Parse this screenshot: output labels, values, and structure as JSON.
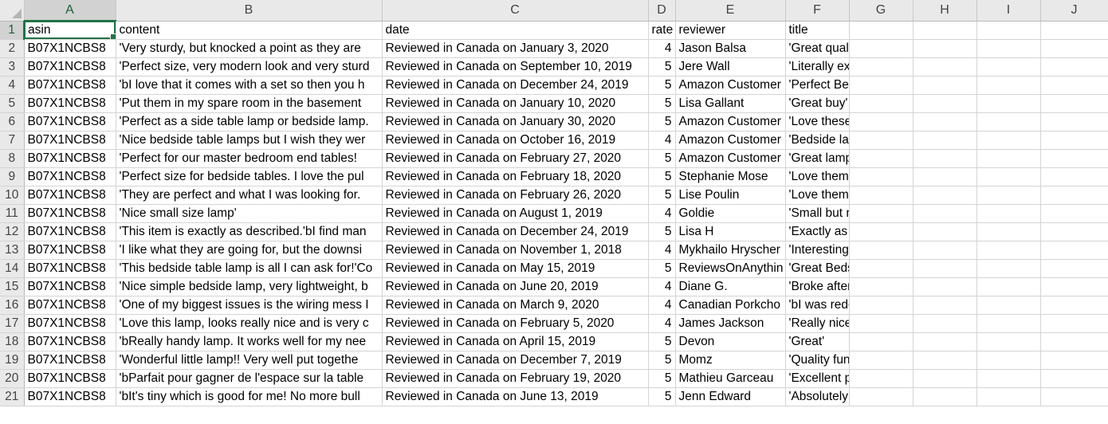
{
  "columns": [
    "A",
    "B",
    "C",
    "D",
    "E",
    "F",
    "G",
    "H",
    "I",
    "J"
  ],
  "header_row": {
    "row_number": "1",
    "cells": [
      "asin",
      "content",
      "date",
      "rate",
      "reviewer",
      "title",
      "",
      "",
      "",
      ""
    ]
  },
  "rows": [
    {
      "n": "2",
      "asin": "B07X1NCBS8",
      "content": "'Very sturdy, but knocked a point as they are",
      "date": "Reviewed in Canada on January 3, 2020",
      "rate": "4",
      "reviewer": "Jason Balsa",
      "title": "'Great quality for the money, but also quite large.'"
    },
    {
      "n": "3",
      "asin": "B07X1NCBS8",
      "content": "'Perfect size, very modern look and very sturd",
      "date": "Reviewed in Canada on September 10, 2019",
      "rate": "5",
      "reviewer": "Jere Wall",
      "title": "'Literally exactly what I was looking for!'"
    },
    {
      "n": "4",
      "asin": "B07X1NCBS8",
      "content": "'bI love that it comes with a set so then you h",
      "date": "Reviewed in Canada on December 24, 2019",
      "rate": "5",
      "reviewer": "Amazon Customer",
      "title": "'Perfect Bedroom Lamps!'"
    },
    {
      "n": "5",
      "asin": "B07X1NCBS8",
      "content": "'Put them in my spare room in the basement",
      "date": "Reviewed in Canada on January 10, 2020",
      "rate": "5",
      "reviewer": "Lisa Gallant",
      "title": "'Great buy'"
    },
    {
      "n": "6",
      "asin": "B07X1NCBS8",
      "content": "'Perfect as a side table lamp or bedside lamp.",
      "date": "Reviewed in Canada on January 30, 2020",
      "rate": "5",
      "reviewer": "Amazon Customer",
      "title": "'Love these lamps'"
    },
    {
      "n": "7",
      "asin": "B07X1NCBS8",
      "content": "'Nice bedside table lamps but I wish they wer",
      "date": "Reviewed in Canada on October 16, 2019",
      "rate": "4",
      "reviewer": "Amazon Customer",
      "title": "'Bedside lamps'"
    },
    {
      "n": "8",
      "asin": "B07X1NCBS8",
      "content": "'Perfect for our master bedroom end tables!",
      "date": "Reviewed in Canada on February 27, 2020",
      "rate": "5",
      "reviewer": "Amazon Customer",
      "title": "'Great lamps, perfect for bedroom'"
    },
    {
      "n": "9",
      "asin": "B07X1NCBS8",
      "content": "'Perfect size for bedside tables. I love the pul",
      "date": "Reviewed in Canada on February 18, 2020",
      "rate": "5",
      "reviewer": "Stephanie Mose",
      "title": "'Love them'"
    },
    {
      "n": "10",
      "asin": "B07X1NCBS8",
      "content": "'They are perfect and what I was looking for.",
      "date": "Reviewed in Canada on February 26, 2020",
      "rate": "5",
      "reviewer": "Lise Poulin",
      "title": "'Love them'"
    },
    {
      "n": "11",
      "asin": "B07X1NCBS8",
      "content": "'Nice small size lamp'",
      "date": "Reviewed in Canada on August 1, 2019",
      "rate": "4",
      "reviewer": "Goldie",
      "title": "'Small but nice'"
    },
    {
      "n": "12",
      "asin": "B07X1NCBS8",
      "content": "'This item is exactly as described.'bI find man",
      "date": "Reviewed in Canada on December 24, 2019",
      "rate": "5",
      "reviewer": "Lisa H",
      "title": "'Exactly as described, and perfect for my needs'"
    },
    {
      "n": "13",
      "asin": "B07X1NCBS8",
      "content": "'I like what they are going for, but the downsi",
      "date": "Reviewed in Canada on November 1, 2018",
      "rate": "4",
      "reviewer": "Mykhailo Hryscher",
      "title": "'Interesting, but could have bought something better.'"
    },
    {
      "n": "14",
      "asin": "B07X1NCBS8",
      "content": "'This bedside table lamp is all I can ask for!'Co",
      "date": "Reviewed in Canada on May 15, 2019",
      "rate": "5",
      "reviewer": "ReviewsOnAnythin",
      "title": "'Great Bedside Table Lamp!'"
    },
    {
      "n": "15",
      "asin": "B07X1NCBS8",
      "content": "'Nice simple bedside lamp, very lightweight, b",
      "date": "Reviewed in Canada on June 20, 2019",
      "rate": "4",
      "reviewer": "Diane G.",
      "title": "'Broke after one tip over'"
    },
    {
      "n": "16",
      "asin": "B07X1NCBS8",
      "content": "'One of my biggest issues is the wiring mess I",
      "date": "Reviewed in Canada on March 9, 2020",
      "rate": "4",
      "reviewer": "Canadian Porkcho",
      "title": "'bI was redoing everything in my bedroom, I've been loo"
    },
    {
      "n": "17",
      "asin": "B07X1NCBS8",
      "content": "'Love this lamp, looks really nice and is very c",
      "date": "Reviewed in Canada on February 5, 2020",
      "rate": "4",
      "reviewer": "James Jackson",
      "title": "'Really nice lamp'"
    },
    {
      "n": "18",
      "asin": "B07X1NCBS8",
      "content": "'bReally handy lamp. It works well for my nee",
      "date": "Reviewed in Canada on April 15, 2019",
      "rate": "5",
      "reviewer": "Devon",
      "title": "'Great'"
    },
    {
      "n": "19",
      "asin": "B07X1NCBS8",
      "content": "'Wonderful little lamp!! Very well put togethe",
      "date": "Reviewed in Canada on December 7, 2019",
      "rate": "5",
      "reviewer": "Momz",
      "title": "'Quality functional item, I love this little lamp!'"
    },
    {
      "n": "20",
      "asin": "B07X1NCBS8",
      "content": "'bParfait pour gagner de l'espace sur la table",
      "date": "Reviewed in Canada on February 19, 2020",
      "rate": "5",
      "reviewer": "Mathieu Garceau",
      "title": "'Excellent produit'"
    },
    {
      "n": "21",
      "asin": "B07X1NCBS8",
      "content": "'bIt's tiny which is good for me! No more bull",
      "date": "Reviewed in Canada on June 13, 2019",
      "rate": "5",
      "reviewer": "Jenn Edward",
      "title": "'Absolutely Love It!'"
    }
  ],
  "colors": {
    "accent": "#217346",
    "header_bg": "#e9e9e9",
    "gridline": "#d4d4d4"
  }
}
